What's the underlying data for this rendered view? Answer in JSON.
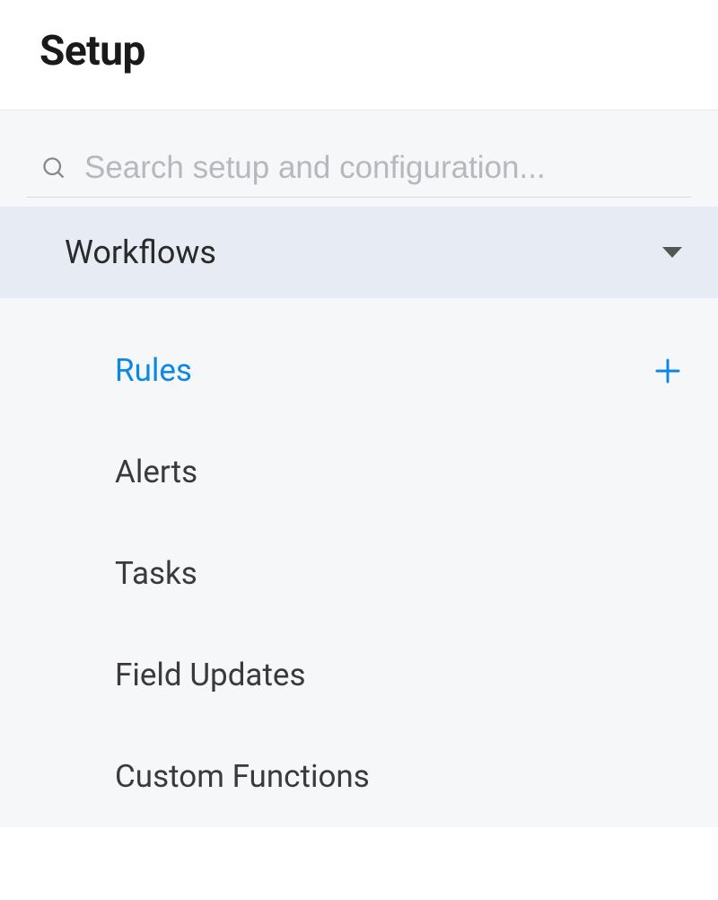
{
  "header": {
    "title": "Setup"
  },
  "search": {
    "placeholder": "Search setup and configuration...",
    "value": ""
  },
  "section": {
    "label": "Workflows"
  },
  "menu": {
    "items": [
      {
        "label": "Rules",
        "active": true,
        "has_add": true
      },
      {
        "label": "Alerts",
        "active": false,
        "has_add": false
      },
      {
        "label": "Tasks",
        "active": false,
        "has_add": false
      },
      {
        "label": "Field Updates",
        "active": false,
        "has_add": false
      },
      {
        "label": "Custom Functions",
        "active": false,
        "has_add": false
      }
    ]
  },
  "colors": {
    "accent": "#0b87e6",
    "section_bg": "#e7ebf3",
    "body_bg": "#f6f7f9"
  }
}
